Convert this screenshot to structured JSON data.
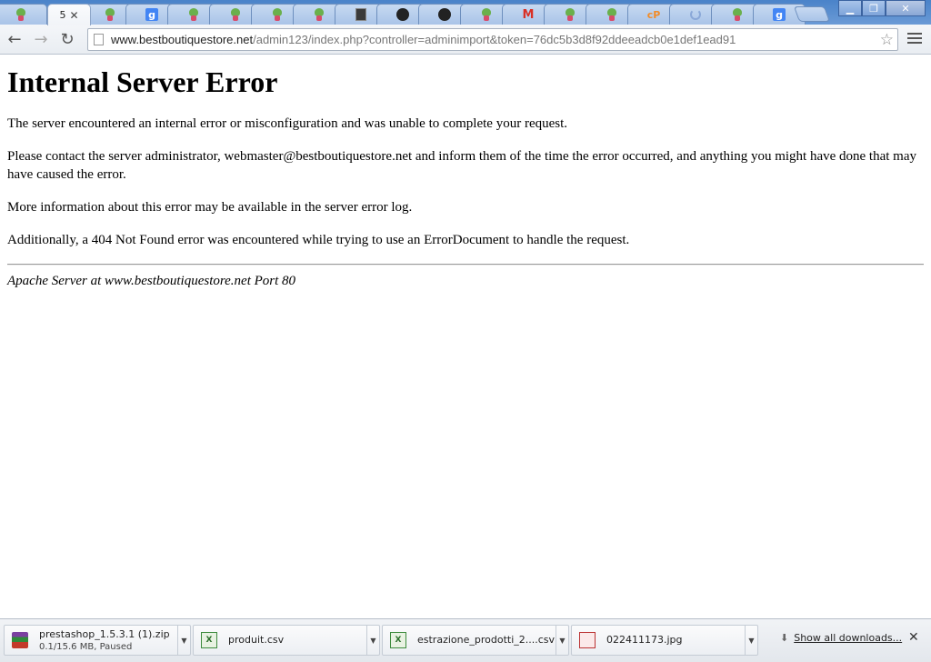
{
  "tabs": [
    {
      "icon": "leaf-favicon"
    },
    {
      "icon": "leaf-favicon",
      "title": "5",
      "active": true
    },
    {
      "icon": "leaf-favicon"
    },
    {
      "icon": "google-favicon",
      "glyph": "g"
    },
    {
      "icon": "leaf-favicon"
    },
    {
      "icon": "leaf-favicon"
    },
    {
      "icon": "leaf-favicon"
    },
    {
      "icon": "leaf-favicon"
    },
    {
      "icon": "dark-favicon"
    },
    {
      "icon": "github-favicon"
    },
    {
      "icon": "github-favicon"
    },
    {
      "icon": "leaf-favicon"
    },
    {
      "icon": "gmail-favicon",
      "glyph": "M"
    },
    {
      "icon": "leaf-favicon"
    },
    {
      "icon": "leaf-favicon"
    },
    {
      "icon": "cpanel-favicon",
      "glyph": "cP"
    },
    {
      "icon": "loading-favicon"
    },
    {
      "icon": "leaf-favicon"
    },
    {
      "icon": "google-favicon",
      "glyph": "g"
    }
  ],
  "toolbar": {
    "url_host": "www.bestboutiquestore.net",
    "url_path": "/admin123/index.php?controller=adminimport&token=76dc5b3d8f92ddeeadcb0e1def1ead91"
  },
  "page": {
    "heading": "Internal Server Error",
    "paragraph1": "The server encountered an internal error or misconfiguration and was unable to complete your request.",
    "paragraph2": "Please contact the server administrator, webmaster@bestboutiquestore.net and inform them of the time the error occurred, and anything you might have done that may have caused the error.",
    "paragraph3": "More information about this error may be available in the server error log.",
    "paragraph4": "Additionally, a 404 Not Found error was encountered while trying to use an ErrorDocument to handle the request.",
    "signature": "Apache Server at www.bestboutiquestore.net Port 80"
  },
  "downloads": {
    "items": [
      {
        "name": "prestashop_1.5.3.1 (1).zip",
        "status": "0.1/15.6 MB, Paused",
        "icon": "rar-archive-icon"
      },
      {
        "name": "produit.csv",
        "icon": "excel-file-icon"
      },
      {
        "name": "estrazione_prodotti_2....csv",
        "icon": "excel-file-icon"
      },
      {
        "name": "022411173.jpg",
        "icon": "image-file-icon"
      }
    ],
    "show_all_label": "Show all downloads..."
  }
}
